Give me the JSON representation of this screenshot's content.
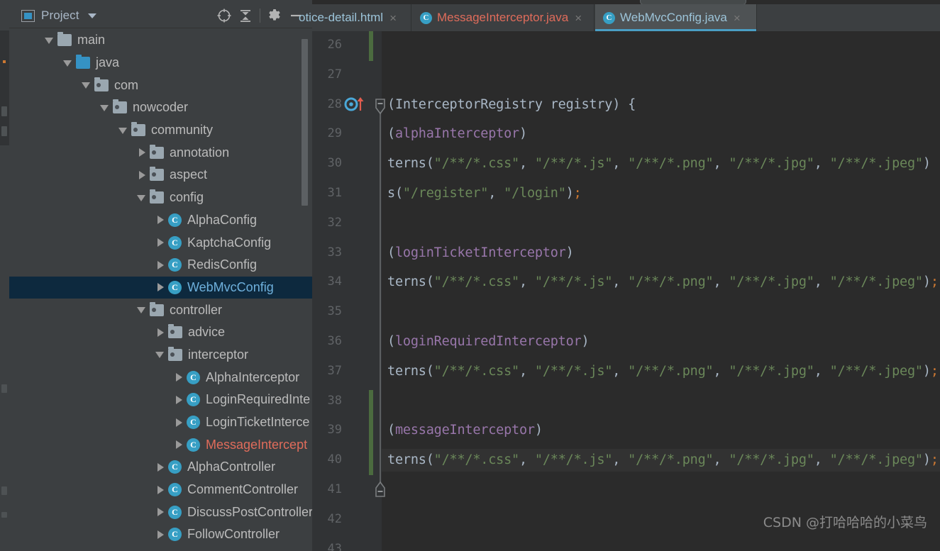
{
  "app": {
    "theme_bg": "#3c3f41",
    "editor_bg": "#2b2b2b",
    "accent": "#4a9ec4",
    "selection_bg": "#0d293e"
  },
  "project_panel": {
    "title": "Project",
    "icons": {
      "window_icon": "project-window-icon",
      "dropdown": "chevron-down-icon",
      "locate": "locate-icon",
      "collapse_all": "collapse-all-icon",
      "settings": "gear-icon",
      "hide": "minimize-icon"
    },
    "tree": [
      {
        "label": "main",
        "indent": 1,
        "arrow": "open",
        "icon": "folder-plain",
        "selected": false,
        "red": false
      },
      {
        "label": "java",
        "indent": 2,
        "arrow": "open",
        "icon": "folder-src",
        "selected": false,
        "red": false
      },
      {
        "label": "com",
        "indent": 3,
        "arrow": "open",
        "icon": "folder-pkg",
        "selected": false,
        "red": false
      },
      {
        "label": "nowcoder",
        "indent": 4,
        "arrow": "open",
        "icon": "folder-pkg",
        "selected": false,
        "red": false
      },
      {
        "label": "community",
        "indent": 5,
        "arrow": "open",
        "icon": "folder-pkg",
        "selected": false,
        "red": false
      },
      {
        "label": "annotation",
        "indent": 6,
        "arrow": "closed",
        "icon": "folder-pkg",
        "selected": false,
        "red": false
      },
      {
        "label": "aspect",
        "indent": 6,
        "arrow": "closed",
        "icon": "folder-pkg",
        "selected": false,
        "red": false
      },
      {
        "label": "config",
        "indent": 6,
        "arrow": "open",
        "icon": "folder-pkg",
        "selected": false,
        "red": false
      },
      {
        "label": "AlphaConfig",
        "indent": 7,
        "arrow": "closed",
        "icon": "class",
        "selected": false,
        "red": false
      },
      {
        "label": "KaptchaConfig",
        "indent": 7,
        "arrow": "closed",
        "icon": "class",
        "selected": false,
        "red": false
      },
      {
        "label": "RedisConfig",
        "indent": 7,
        "arrow": "closed",
        "icon": "class",
        "selected": false,
        "red": false
      },
      {
        "label": "WebMvcConfig",
        "indent": 7,
        "arrow": "closed",
        "icon": "class",
        "selected": true,
        "red": false
      },
      {
        "label": "controller",
        "indent": 6,
        "arrow": "open",
        "icon": "folder-pkg",
        "selected": false,
        "red": false
      },
      {
        "label": "advice",
        "indent": 7,
        "arrow": "closed",
        "icon": "folder-pkg",
        "selected": false,
        "red": false
      },
      {
        "label": "interceptor",
        "indent": 7,
        "arrow": "open",
        "icon": "folder-pkg",
        "selected": false,
        "red": false
      },
      {
        "label": "AlphaInterceptor",
        "indent": 8,
        "arrow": "closed",
        "icon": "class",
        "selected": false,
        "red": false
      },
      {
        "label": "LoginRequiredInte",
        "indent": 8,
        "arrow": "closed",
        "icon": "class",
        "selected": false,
        "red": false
      },
      {
        "label": "LoginTicketInterce",
        "indent": 8,
        "arrow": "closed",
        "icon": "class",
        "selected": false,
        "red": false
      },
      {
        "label": "MessageIntercept",
        "indent": 8,
        "arrow": "closed",
        "icon": "class",
        "selected": false,
        "red": true
      },
      {
        "label": "AlphaController",
        "indent": 7,
        "arrow": "closed",
        "icon": "class",
        "selected": false,
        "red": false
      },
      {
        "label": "CommentController",
        "indent": 7,
        "arrow": "closed",
        "icon": "class",
        "selected": false,
        "red": false
      },
      {
        "label": "DiscussPostController",
        "indent": 7,
        "arrow": "closed",
        "icon": "class",
        "selected": false,
        "red": false
      },
      {
        "label": "FollowController",
        "indent": 7,
        "arrow": "closed",
        "icon": "class",
        "selected": false,
        "red": false
      }
    ]
  },
  "editor": {
    "tabs": [
      {
        "label": "otice-detail.html",
        "icon": "html-file-icon",
        "color": "blue",
        "active": false,
        "close": "×"
      },
      {
        "label": "MessageInterceptor.java",
        "icon": "java-class-icon",
        "color": "red",
        "active": false,
        "close": "×"
      },
      {
        "label": "WebMvcConfig.java",
        "icon": "java-class-icon",
        "color": "blue",
        "active": true,
        "close": "×"
      }
    ],
    "line_numbers": [
      "26",
      "27",
      "28",
      "29",
      "30",
      "31",
      "32",
      "33",
      "34",
      "35",
      "36",
      "37",
      "38",
      "39",
      "40",
      "41",
      "42",
      "43"
    ],
    "code_lines": [
      {
        "num": "26",
        "segments": []
      },
      {
        "num": "27",
        "segments": []
      },
      {
        "num": "28",
        "segments": [
          {
            "t": "(InterceptorRegistry registry) {",
            "c": "s-type"
          }
        ]
      },
      {
        "num": "29",
        "segments": [
          {
            "t": "(",
            "c": "s-punc"
          },
          {
            "t": "alphaInterceptor",
            "c": "s-ident"
          },
          {
            "t": ")",
            "c": "s-punc"
          }
        ]
      },
      {
        "num": "30",
        "segments": [
          {
            "t": "terns",
            "c": "s-fn"
          },
          {
            "t": "(",
            "c": "s-punc"
          },
          {
            "t": "\"/**/*.css\"",
            "c": "s-str"
          },
          {
            "t": ", ",
            "c": "s-punc"
          },
          {
            "t": "\"/**/*.js\"",
            "c": "s-str"
          },
          {
            "t": ", ",
            "c": "s-punc"
          },
          {
            "t": "\"/**/*.png\"",
            "c": "s-str"
          },
          {
            "t": ", ",
            "c": "s-punc"
          },
          {
            "t": "\"/**/*.jpg\"",
            "c": "s-str"
          },
          {
            "t": ", ",
            "c": "s-punc"
          },
          {
            "t": "\"/**/*.jpeg\"",
            "c": "s-str"
          },
          {
            "t": ")",
            "c": "s-punc"
          }
        ]
      },
      {
        "num": "31",
        "segments": [
          {
            "t": "s",
            "c": "s-fn"
          },
          {
            "t": "(",
            "c": "s-punc"
          },
          {
            "t": "\"/register\"",
            "c": "s-str"
          },
          {
            "t": ", ",
            "c": "s-punc"
          },
          {
            "t": "\"/login\"",
            "c": "s-str"
          },
          {
            "t": ")",
            "c": "s-punc"
          },
          {
            "t": ";",
            "c": "s-semi"
          }
        ]
      },
      {
        "num": "32",
        "segments": []
      },
      {
        "num": "33",
        "segments": [
          {
            "t": "(",
            "c": "s-punc"
          },
          {
            "t": "loginTicketInterceptor",
            "c": "s-ident"
          },
          {
            "t": ")",
            "c": "s-punc"
          }
        ]
      },
      {
        "num": "34",
        "segments": [
          {
            "t": "terns",
            "c": "s-fn"
          },
          {
            "t": "(",
            "c": "s-punc"
          },
          {
            "t": "\"/**/*.css\"",
            "c": "s-str"
          },
          {
            "t": ", ",
            "c": "s-punc"
          },
          {
            "t": "\"/**/*.js\"",
            "c": "s-str"
          },
          {
            "t": ", ",
            "c": "s-punc"
          },
          {
            "t": "\"/**/*.png\"",
            "c": "s-str"
          },
          {
            "t": ", ",
            "c": "s-punc"
          },
          {
            "t": "\"/**/*.jpg\"",
            "c": "s-str"
          },
          {
            "t": ", ",
            "c": "s-punc"
          },
          {
            "t": "\"/**/*.jpeg\"",
            "c": "s-str"
          },
          {
            "t": ")",
            "c": "s-punc"
          },
          {
            "t": ";",
            "c": "s-semi"
          }
        ]
      },
      {
        "num": "35",
        "segments": []
      },
      {
        "num": "36",
        "segments": [
          {
            "t": "(",
            "c": "s-punc"
          },
          {
            "t": "loginRequiredInterceptor",
            "c": "s-ident"
          },
          {
            "t": ")",
            "c": "s-punc"
          }
        ]
      },
      {
        "num": "37",
        "segments": [
          {
            "t": "terns",
            "c": "s-fn"
          },
          {
            "t": "(",
            "c": "s-punc"
          },
          {
            "t": "\"/**/*.css\"",
            "c": "s-str"
          },
          {
            "t": ", ",
            "c": "s-punc"
          },
          {
            "t": "\"/**/*.js\"",
            "c": "s-str"
          },
          {
            "t": ", ",
            "c": "s-punc"
          },
          {
            "t": "\"/**/*.png\"",
            "c": "s-str"
          },
          {
            "t": ", ",
            "c": "s-punc"
          },
          {
            "t": "\"/**/*.jpg\"",
            "c": "s-str"
          },
          {
            "t": ", ",
            "c": "s-punc"
          },
          {
            "t": "\"/**/*.jpeg\"",
            "c": "s-str"
          },
          {
            "t": ")",
            "c": "s-punc"
          },
          {
            "t": ";",
            "c": "s-semi"
          }
        ]
      },
      {
        "num": "38",
        "segments": []
      },
      {
        "num": "39",
        "segments": [
          {
            "t": "(",
            "c": "s-punc"
          },
          {
            "t": "messageInterceptor",
            "c": "s-ident"
          },
          {
            "t": ")",
            "c": "s-punc"
          }
        ]
      },
      {
        "num": "40",
        "segments": [
          {
            "t": "terns",
            "c": "s-fn"
          },
          {
            "t": "(",
            "c": "s-punc"
          },
          {
            "t": "\"/**/*.css\"",
            "c": "s-str"
          },
          {
            "t": ", ",
            "c": "s-punc"
          },
          {
            "t": "\"/**/*.js\"",
            "c": "s-str"
          },
          {
            "t": ", ",
            "c": "s-punc"
          },
          {
            "t": "\"/**/*.png\"",
            "c": "s-str"
          },
          {
            "t": ", ",
            "c": "s-punc"
          },
          {
            "t": "\"/**/*.jpg\"",
            "c": "s-str"
          },
          {
            "t": ", ",
            "c": "s-punc"
          },
          {
            "t": "\"/**/*.jpeg\"",
            "c": "s-str"
          },
          {
            "t": ")",
            "c": "s-punc"
          },
          {
            "t": ";",
            "c": "s-semi"
          }
        ]
      },
      {
        "num": "41",
        "segments": []
      },
      {
        "num": "42",
        "segments": []
      },
      {
        "num": "43",
        "segments": []
      }
    ],
    "gutter_icons": {
      "override_marker": "override-method-icon",
      "fold_collapse": "fold-collapse-icon",
      "vcs_changed": "vcs-changed-marker"
    }
  },
  "watermark": "CSDN @打哈哈哈的小菜鸟"
}
